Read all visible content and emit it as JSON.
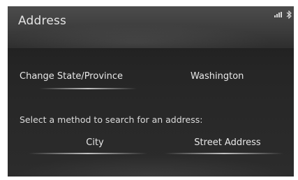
{
  "header": {
    "title": "Address"
  },
  "status": {
    "icons": [
      "signal-icon",
      "bluetooth-icon"
    ]
  },
  "state_row": {
    "label": "Change State/Province",
    "value": "Washington"
  },
  "search": {
    "prompt": "Select a method to search for an address:",
    "options": [
      {
        "label": "City"
      },
      {
        "label": "Street Address"
      }
    ]
  }
}
